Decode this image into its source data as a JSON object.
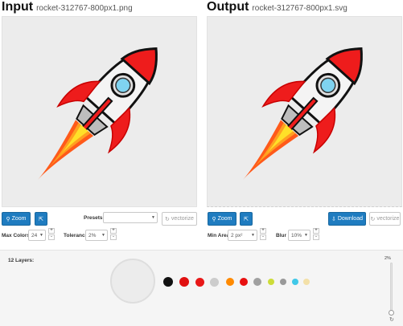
{
  "input": {
    "title": "Input",
    "filename": "rocket-312767-800px1.png",
    "zoom_label": "Zoom",
    "presets_label": "Presets",
    "presets_value": "",
    "vectorize_label": "vectorize",
    "max_colors_label": "Max Colors",
    "max_colors_value": "24",
    "tolerance_label": "Tolerance",
    "tolerance_value": "2%"
  },
  "output": {
    "title": "Output",
    "filename": "rocket-312767-800px1.svg",
    "zoom_label": "Zoom",
    "download_label": "Download",
    "vectorize_label": "vectorize",
    "min_area_label": "Min Area",
    "min_area_value": "2 px²",
    "blur_label": "Blur",
    "blur_value": "10%"
  },
  "layers": {
    "label": "12 Layers:",
    "slider_value": "2%",
    "colors": [
      "#111111",
      "#e01010",
      "#e81818",
      "#cccccc",
      "#ff8a00",
      "#e81010",
      "#a0a0a0",
      "#cddc39",
      "#999999",
      "#40c8e8",
      "#f3e0a8"
    ]
  }
}
